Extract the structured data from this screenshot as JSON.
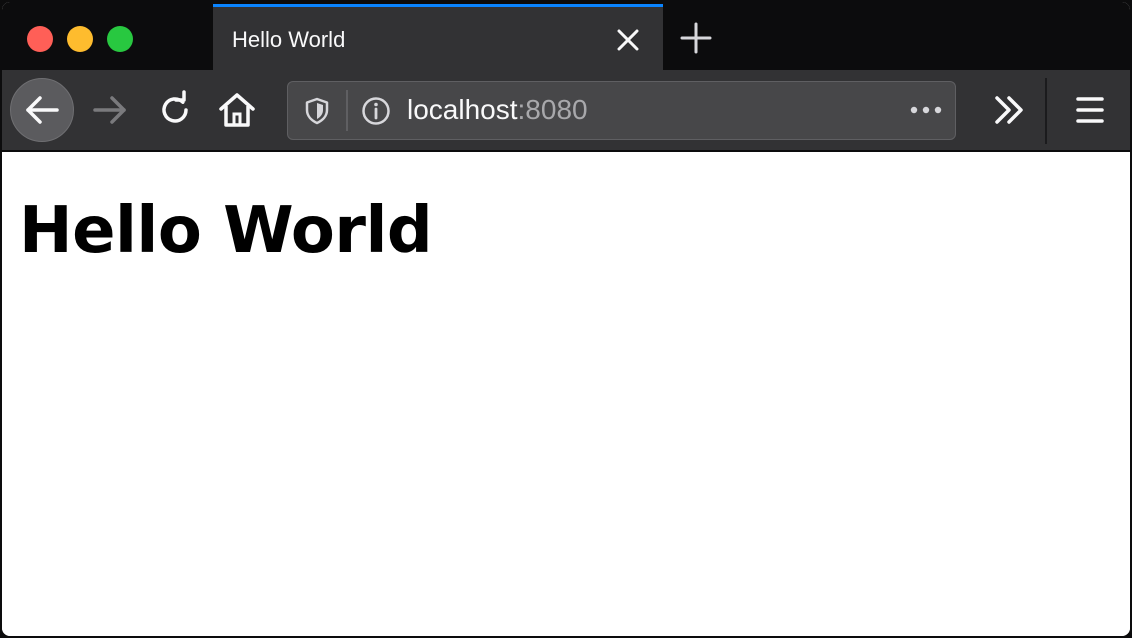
{
  "browser": {
    "tab": {
      "title": "Hello World",
      "close_icon": "close-icon"
    },
    "new_tab_icon": "plus-icon",
    "toolbar": {
      "back_icon": "arrow-left-icon",
      "forward_icon": "arrow-right-icon",
      "reload_icon": "reload-icon",
      "home_icon": "home-icon",
      "overflow_icon": "chevron-double-right-icon",
      "menu_icon": "hamburger-menu-icon"
    },
    "urlbar": {
      "tracking_icon": "shield-icon",
      "info_icon": "info-icon",
      "host": "localhost",
      "port": ":8080",
      "page_actions_icon": "ellipsis-icon"
    },
    "colors": {
      "accent": "#0a84ff",
      "tab_bg": "#323234",
      "titlebar_bg": "#0c0c0d",
      "close": "#ff5f57",
      "minimize": "#febc2e",
      "maximize": "#28c840"
    }
  },
  "page": {
    "heading": "Hello World"
  }
}
